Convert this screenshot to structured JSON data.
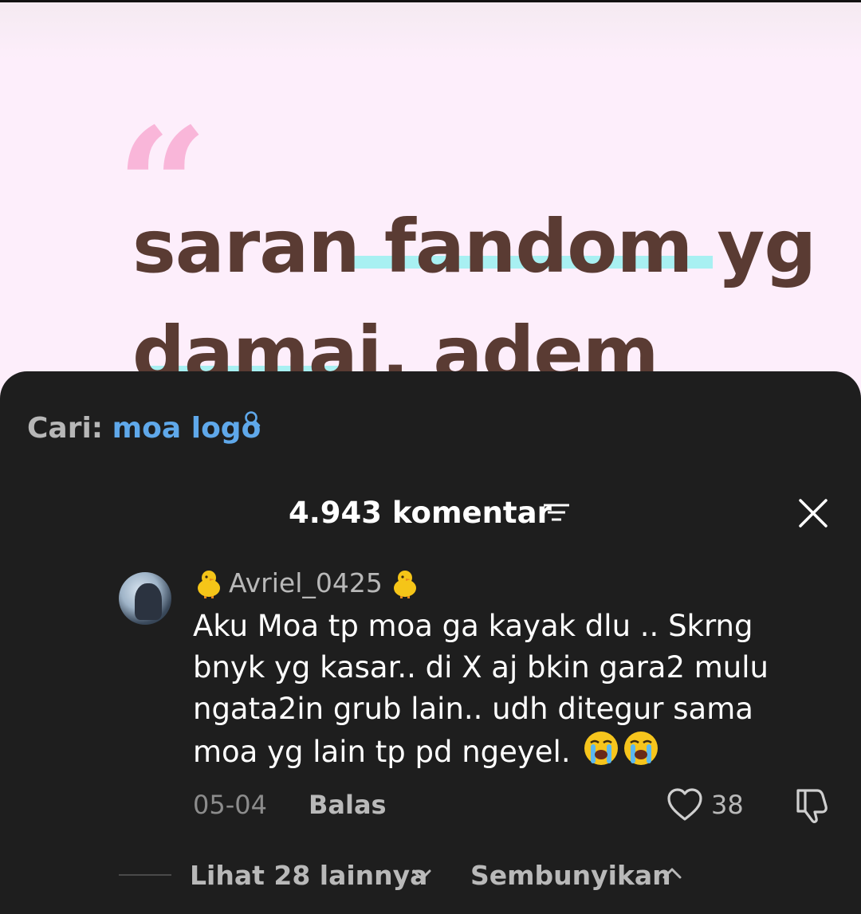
{
  "background_card": {
    "quote_mark": "“",
    "headline_line1": "saran fandom yg",
    "headline_line2": "damai, adem",
    "accent_color": "#a8f0f2",
    "quote_color": "#f9b6d9",
    "text_color": "#5a3b33"
  },
  "comments_sheet": {
    "search": {
      "prefix": "Cari:",
      "term": "moa logo"
    },
    "header": {
      "title": "4.943 komentar"
    },
    "comment": {
      "username": "Avriel_0425",
      "username_decoration": "🐥",
      "text": "Aku Moa tp moa ga kayak dlu .. Skrng bnyk yg kasar.. di X aj bkin gara2 mulu ngata2in grub lain.. udh ditegur sama moa yg lain tp pd ngeyel.",
      "emoji": "😭😭",
      "date": "05-04",
      "reply_label": "Balas",
      "like_count": "38"
    },
    "replies": {
      "more_label": "Lihat 28 lainnya",
      "hide_label": "Sembunyikan"
    }
  }
}
